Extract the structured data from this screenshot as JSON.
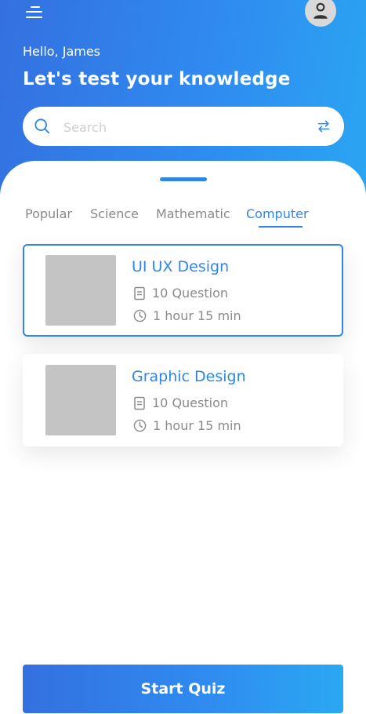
{
  "header": {
    "greeting": "Hello, James",
    "headline": "Let's test your knowledge"
  },
  "search": {
    "placeholder": "Search",
    "value": ""
  },
  "tabs": [
    {
      "label": "Popular",
      "active": false
    },
    {
      "label": "Science",
      "active": false
    },
    {
      "label": "Mathematic",
      "active": false
    },
    {
      "label": "Computer",
      "active": true
    }
  ],
  "quizzes": [
    {
      "title": "UI UX Design",
      "questions": "10 Question",
      "duration": "1 hour 15 min",
      "selected": true
    },
    {
      "title": "Graphic Design",
      "questions": "10 Question",
      "duration": "1 hour 15 min",
      "selected": false
    }
  ],
  "footer": {
    "start_label": "Start Quiz"
  },
  "colors": {
    "accent": "#2f86e6",
    "gradient_start": "#3470e0",
    "gradient_end": "#2aa6f2",
    "muted_text": "#8a8a8a",
    "thumbnail": "#c4c4c4"
  },
  "icons": {
    "menu": "menu-icon",
    "profile": "user-icon",
    "search": "search-icon",
    "filter": "swap-arrows-icon",
    "questions": "document-icon",
    "duration": "clock-icon"
  }
}
